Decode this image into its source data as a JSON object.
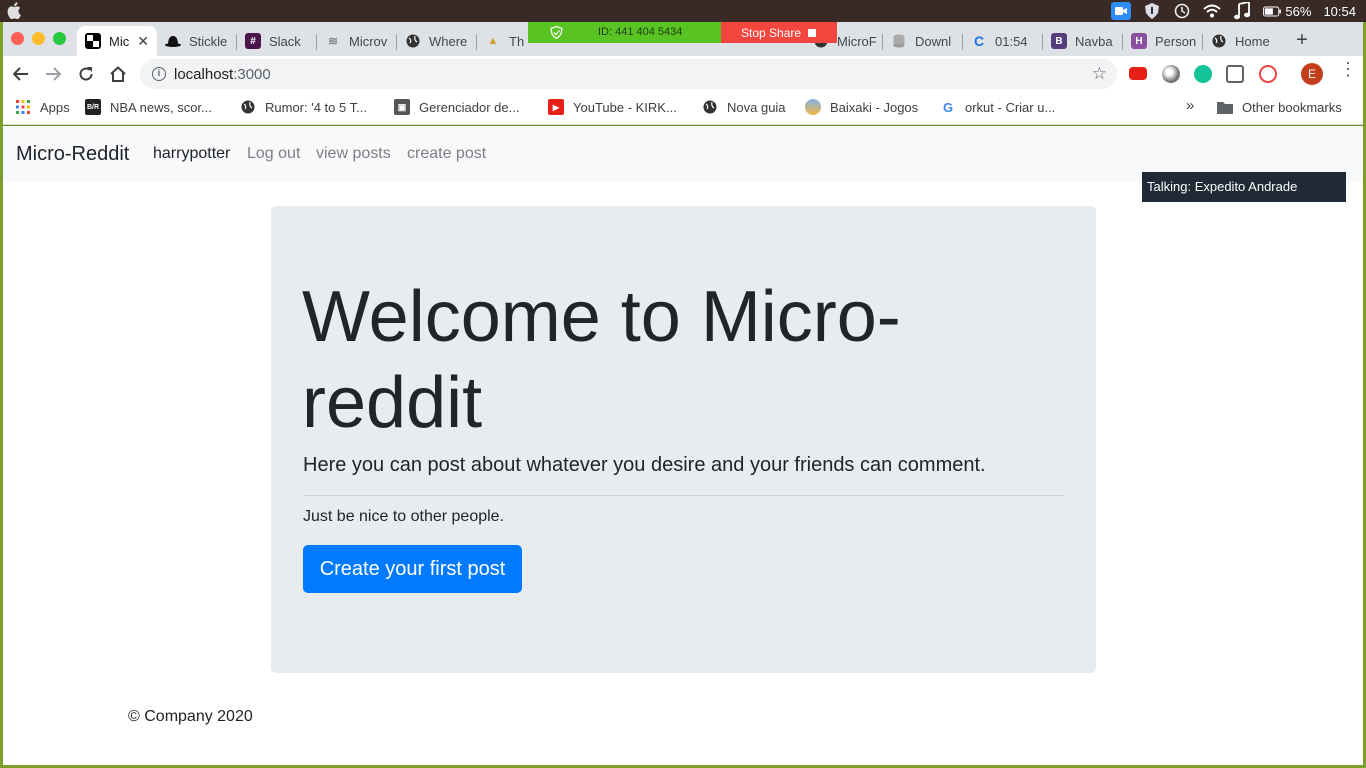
{
  "menubar": {
    "battery": "56%",
    "clock": "10:54"
  },
  "tabs": [
    {
      "label": "Mic",
      "active": true
    },
    {
      "label": "Stickle"
    },
    {
      "label": "Slack"
    },
    {
      "label": "Microv"
    },
    {
      "label": "Where"
    },
    {
      "label": "Th"
    },
    {
      "label": "MicroF"
    },
    {
      "label": "Downl"
    },
    {
      "label": "01:54"
    },
    {
      "label": "Navba"
    },
    {
      "label": "Person"
    },
    {
      "label": "Home"
    }
  ],
  "share": {
    "id_text": "ID: 441 404 5434",
    "stop_label": "Stop Share"
  },
  "toolbar": {
    "url_host": "localhost",
    "url_port": ":3000"
  },
  "profile_initial": "E",
  "bookmarks": {
    "items": [
      {
        "label": "Apps"
      },
      {
        "label": "NBA news, scor..."
      },
      {
        "label": "Rumor: '4 to 5 T..."
      },
      {
        "label": "Gerenciador de..."
      },
      {
        "label": "YouTube - KIRK..."
      },
      {
        "label": "Nova guia"
      },
      {
        "label": "Baixaki - Jogos"
      },
      {
        "label": "orkut - Criar u..."
      }
    ],
    "overflow": "»",
    "other": "Other bookmarks"
  },
  "navbar": {
    "brand": "Micro-Reddit",
    "user": "harrypotter",
    "logout": "Log out",
    "view_posts": "view posts",
    "create_post": "create post"
  },
  "talking": "Talking: Expedito Andrade",
  "jumbotron": {
    "title": "Welcome to Micro-reddit",
    "lead": "Here you can post about whatever you desire and your friends can comment.",
    "note": "Just be nice to other people.",
    "button": "Create your first post"
  },
  "footer": "© Company 2020"
}
